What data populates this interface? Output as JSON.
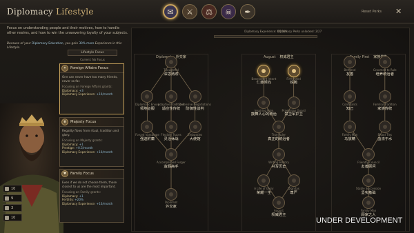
{
  "header": {
    "title_prefix": "Diplomacy",
    "title_accent": "Lifestyle",
    "reset_label": "Reset Perks",
    "close_glyph": "✕"
  },
  "lifestyles": [
    {
      "icon": "diplomacy-lifestyle-icon",
      "glyph": "✉",
      "color": "#3a3550",
      "selected": true
    },
    {
      "icon": "martial-lifestyle-icon",
      "glyph": "⚔",
      "color": "#4a3b2a",
      "selected": false
    },
    {
      "icon": "stewardship-lifestyle-icon",
      "glyph": "⚖",
      "color": "#4a2a22",
      "selected": false
    },
    {
      "icon": "intrigue-lifestyle-icon",
      "glyph": "☠",
      "color": "#3a2a48",
      "selected": false
    },
    {
      "icon": "learning-lifestyle-icon",
      "glyph": "✒",
      "color": "#3b3329",
      "selected": false
    }
  ],
  "description": "Focus on understanding people and their motives, how to handle other realms, and how to win the unwavering loyalty of your subjects.",
  "education": {
    "pre": "Because of your",
    "link": "Diplomacy Education",
    "mid": ", you gain",
    "value": "30% more",
    "post": "Experience in this Lifestyle."
  },
  "focus_tab": "Lifestyle Focus",
  "current": "Current: No Focus",
  "stats": [
    "10",
    "9",
    "3",
    "10"
  ],
  "focuses": [
    {
      "name": "Foreign Affairs Focus",
      "glyph": "✦",
      "selected": true,
      "text": "One can never have too many friends, never so far.",
      "grants_label": "Focusing on Foreign Affairs grants:",
      "lines": [
        [
          "Diplomacy:",
          "+3"
        ],
        [
          "Diplomacy Experience:",
          "+10/month"
        ]
      ]
    },
    {
      "name": "Majesty Focus",
      "glyph": "♛",
      "selected": false,
      "text": "Regality flows from ritual, tradition and glory.",
      "grants_label": "Focusing on Majesty grants:",
      "lines": [
        [
          "Diplomacy:",
          "+1"
        ],
        [
          "Prestige:",
          "+0.5/month"
        ],
        [
          "Diplomacy Experience:",
          "+10/month"
        ]
      ]
    },
    {
      "name": "Family Focus",
      "glyph": "♥",
      "selected": false,
      "text": "Even if we do not choose them, those closest to us are the most important.",
      "grants_label": "Focusing on Family grants:",
      "lines": [
        [
          "Diplomacy:",
          "+1"
        ],
        [
          "Fertility:",
          "+20%"
        ],
        [
          "Diplomacy Experience:",
          "+10/month"
        ]
      ]
    }
  ],
  "progress": {
    "xp_label": "Diplomacy Experience: 0/1000",
    "perks_label": "Diplomacy Perks unlocked: 2/27",
    "fraction": 0.0
  },
  "trees": [
    {
      "name": "Diplomat",
      "name_cn": "外交家",
      "nodes": [
        {
          "en": "Thoughtful",
          "cn": "深思熟虑"
        },
        {
          "en": "Diplomatic Envoy",
          "cn": "领地征服"
        },
        {
          "en": "Adaptive Traditions",
          "cn": "适应性传统"
        },
        {
          "en": "Defensive Negotiations",
          "cn": "防御性谈判"
        },
        {
          "en": "Forced Vassalage",
          "cn": "强迫附庸"
        },
        {
          "en": "Flexible Truces",
          "cn": "灵活休战"
        },
        {
          "en": "Embassies",
          "cn": "大使馆"
        },
        {
          "en": "Accomplished Forger",
          "cn": "造假高手"
        },
        {
          "en": "Diplomat",
          "cn": "外交家"
        }
      ]
    },
    {
      "name": "August",
      "name_cn": "权威君主",
      "nodes": [
        {
          "en": "Benevolent Intent",
          "cn": "仁慈倾向",
          "got": true
        },
        {
          "en": "Firm Hand",
          "cn": "铁腕",
          "got": true
        },
        {
          "en": "Inspiring Rule",
          "cn": "鼓舞人心的统治"
        },
        {
          "en": "Praetorian Guard",
          "cn": "禁卫军护卫"
        },
        {
          "en": "True Ruler",
          "cn": "真正的统治者"
        },
        {
          "en": "Writing History",
          "cn": "书写历史"
        },
        {
          "en": "A Life of Glory",
          "cn": "荣耀一生"
        },
        {
          "en": "Dignitas",
          "cn": "尊严"
        },
        {
          "en": "August",
          "cn": "权威君主"
        }
      ]
    },
    {
      "name": "Family First",
      "name_cn": "家族优先",
      "nodes": [
        {
          "en": "Befriend",
          "cn": "友善"
        },
        {
          "en": "Groomed to Rule",
          "cn": "培养统治者"
        },
        {
          "en": "Confidants",
          "cn": "知己"
        },
        {
          "en": "Familial Tradition",
          "cn": "家族传统"
        },
        {
          "en": "Family Man",
          "cn": "马放精"
        },
        {
          "en": "Blood Ties",
          "cn": "血浓于水"
        },
        {
          "en": "Friendly Council",
          "cn": "友善顾问"
        },
        {
          "en": "Stable Succession",
          "cn": "坚实基础"
        },
        {
          "en": "Family Man",
          "cn": "顾家之人"
        }
      ]
    }
  ],
  "watermark": "UNDER DEVELOPMENT"
}
